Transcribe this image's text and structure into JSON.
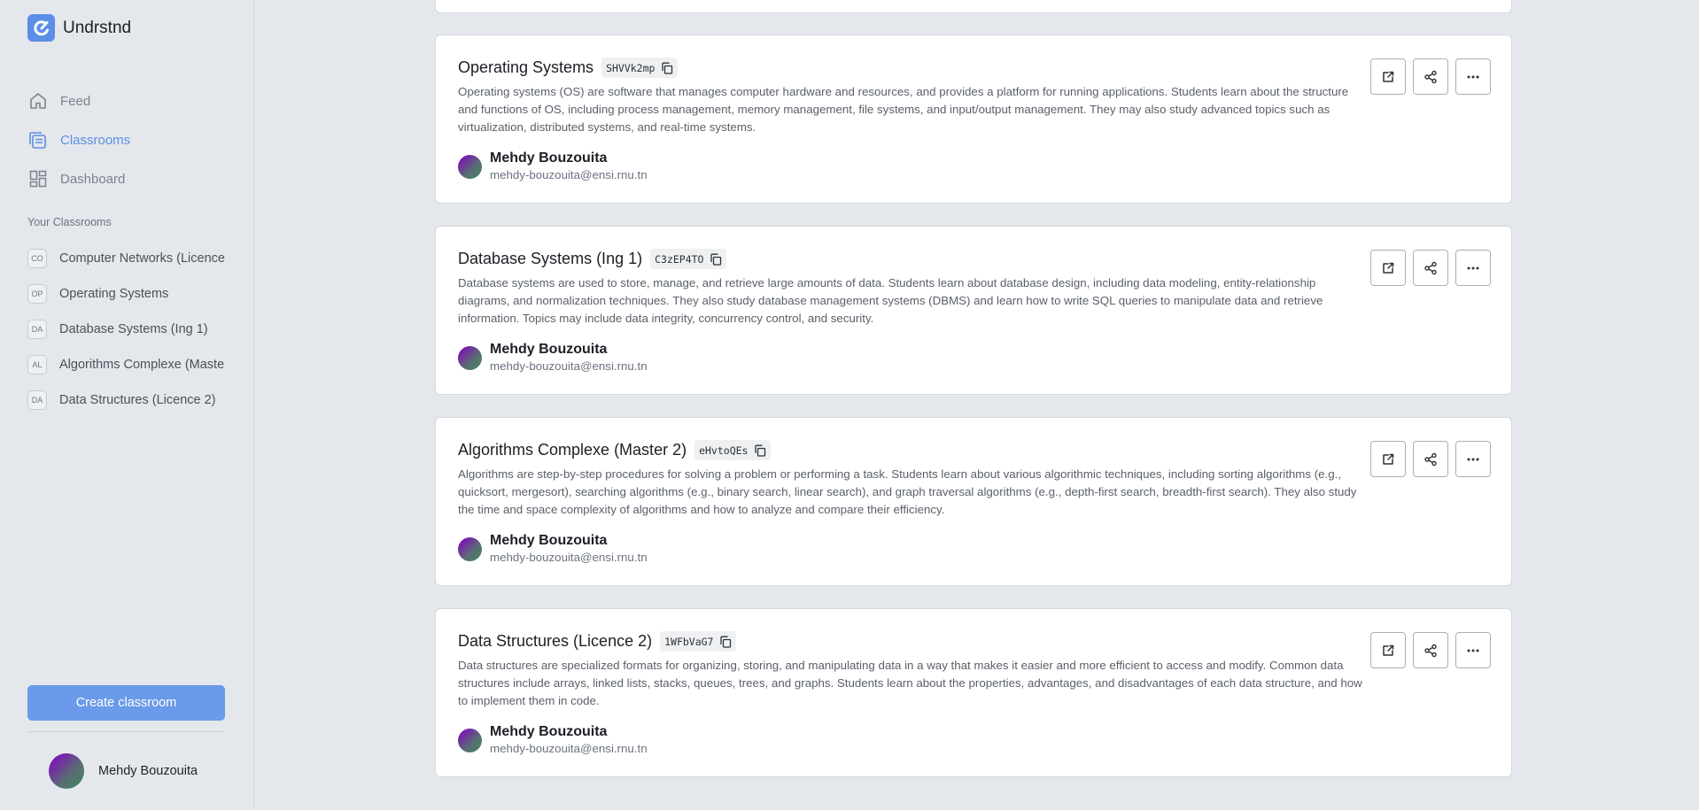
{
  "app": {
    "name": "Undrstnd"
  },
  "nav": [
    {
      "label": "Feed",
      "icon": "home-icon",
      "active": false
    },
    {
      "label": "Classrooms",
      "icon": "classrooms-icon",
      "active": true
    },
    {
      "label": "Dashboard",
      "icon": "dashboard-icon",
      "active": false
    }
  ],
  "sidebar": {
    "section_title": "Your Classrooms",
    "classrooms": [
      {
        "badge": "CO",
        "name": "Computer Networks (Licence"
      },
      {
        "badge": "OP",
        "name": "Operating Systems"
      },
      {
        "badge": "DA",
        "name": "Database Systems (Ing 1)"
      },
      {
        "badge": "AL",
        "name": "Algorithms Complexe (Maste"
      },
      {
        "badge": "DA",
        "name": "Data Structures (Licence 2)"
      }
    ],
    "create_label": "Create classroom",
    "user_name": "Mehdy Bouzouita"
  },
  "cards": [
    {
      "title": "Operating Systems",
      "code": "SHVVk2mp",
      "description": "Operating systems (OS) are software that manages computer hardware and resources, and provides a platform for running applications. Students learn about the structure and functions of OS, including process management, memory management, file systems, and input/output management. They may also study advanced topics such as virtualization, distributed systems, and real-time systems.",
      "author_name": "Mehdy Bouzouita",
      "author_email": "mehdy-bouzouita@ensi.rnu.tn"
    },
    {
      "title": "Database Systems (Ing 1)",
      "code": "C3zEP4TO",
      "description": "Database systems are used to store, manage, and retrieve large amounts of data. Students learn about database design, including data modeling, entity-relationship diagrams, and normalization techniques. They also study database management systems (DBMS) and learn how to write SQL queries to manipulate data and retrieve information. Topics may include data integrity, concurrency control, and security.",
      "author_name": "Mehdy Bouzouita",
      "author_email": "mehdy-bouzouita@ensi.rnu.tn"
    },
    {
      "title": "Algorithms Complexe (Master 2)",
      "code": "eHvtoQEs",
      "description": "Algorithms are step-by-step procedures for solving a problem or performing a task. Students learn about various algorithmic techniques, including sorting algorithms (e.g., quicksort, mergesort), searching algorithms (e.g., binary search, linear search), and graph traversal algorithms (e.g., depth-first search, breadth-first search). They also study the time and space complexity of algorithms and how to analyze and compare their efficiency.",
      "author_name": "Mehdy Bouzouita",
      "author_email": "mehdy-bouzouita@ensi.rnu.tn"
    },
    {
      "title": "Data Structures (Licence 2)",
      "code": "1WFbVaG7",
      "description": "Data structures are specialized formats for organizing, storing, and manipulating data in a way that makes it easier and more efficient to access and modify. Common data structures include arrays, linked lists, stacks, queues, trees, and graphs. Students learn about the properties, advantages, and disadvantages of each data structure, and how to implement them in code.",
      "author_name": "Mehdy Bouzouita",
      "author_email": "mehdy-bouzouita@ensi.rnu.tn"
    }
  ],
  "card_actions": [
    {
      "icon": "external-link-icon"
    },
    {
      "icon": "share-icon"
    },
    {
      "icon": "more-options-icon"
    }
  ],
  "colors": {
    "accent": "#5b8ee6",
    "button": "#6a9ae9",
    "background": "#e4e7eb",
    "card": "#ffffff"
  }
}
